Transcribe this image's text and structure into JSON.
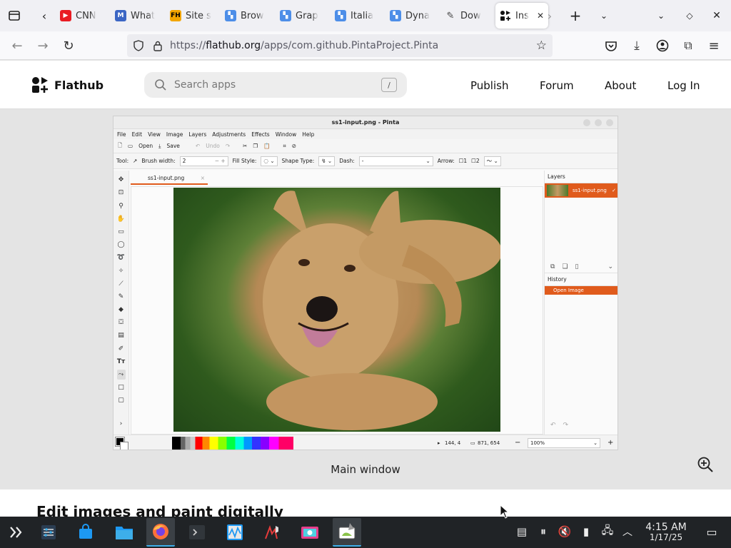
{
  "browser": {
    "tabs": [
      {
        "label": "CNN",
        "fav_color": "#e91c23",
        "fav_text": "▶"
      },
      {
        "label": "What",
        "fav_color": "#3b66c4",
        "fav_text": "M"
      },
      {
        "label": "Site s",
        "fav_color": "#f2a600",
        "fav_text": "FH"
      },
      {
        "label": "Brow",
        "fav_color": "#4d8ee8",
        "fav_text": "▚"
      },
      {
        "label": "Grap",
        "fav_color": "#4d8ee8",
        "fav_text": "▚"
      },
      {
        "label": "Italia",
        "fav_color": "#4d8ee8",
        "fav_text": "▚"
      },
      {
        "label": "Dyna",
        "fav_color": "#4d8ee8",
        "fav_text": "▚"
      },
      {
        "label": "Dow",
        "fav_color": "#444444",
        "fav_text": "✎"
      }
    ],
    "active_tab": {
      "label": "Ins"
    },
    "url": {
      "prefix": "https://",
      "host": "flathub.org",
      "path": "/apps/com.github.PintaProject.Pinta"
    }
  },
  "flathub": {
    "brand": "Flathub",
    "search_placeholder": "Search apps",
    "search_shortcut": "/",
    "nav": {
      "publish": "Publish",
      "forum": "Forum",
      "about": "About",
      "login": "Log In"
    },
    "caption": "Main window",
    "heading": "Edit images and paint digitally"
  },
  "pinta": {
    "title": "ss1-input.png - Pinta",
    "menus": [
      "File",
      "Edit",
      "View",
      "Image",
      "Layers",
      "Adjustments",
      "Effects",
      "Window",
      "Help"
    ],
    "toolbar": {
      "open": "Open",
      "save": "Save",
      "undo": "Undo"
    },
    "options": {
      "tool": "Tool:",
      "brush_width_label": "Brush width:",
      "brush_width": "2",
      "fill_style": "Fill Style:",
      "shape_type": "Shape Type:",
      "dash_label": "Dash:",
      "dash_value": "-",
      "arrow": "Arrow:",
      "arrow1": "1",
      "arrow2": "2"
    },
    "doc_tab": "ss1-input.png",
    "layers_title": "Layers",
    "layer_name": "ss1-input.png",
    "history_title": "History",
    "history_item": "Open Image",
    "status": {
      "cursor": "144, 4",
      "selection": "871, 654",
      "zoom": "100%"
    }
  },
  "taskbar": {
    "time": "4:15 AM",
    "date": "1/17/25"
  },
  "colors": {
    "accent": "#e05b1c",
    "taskbar": "#202326",
    "highlight": "#3daee9"
  }
}
